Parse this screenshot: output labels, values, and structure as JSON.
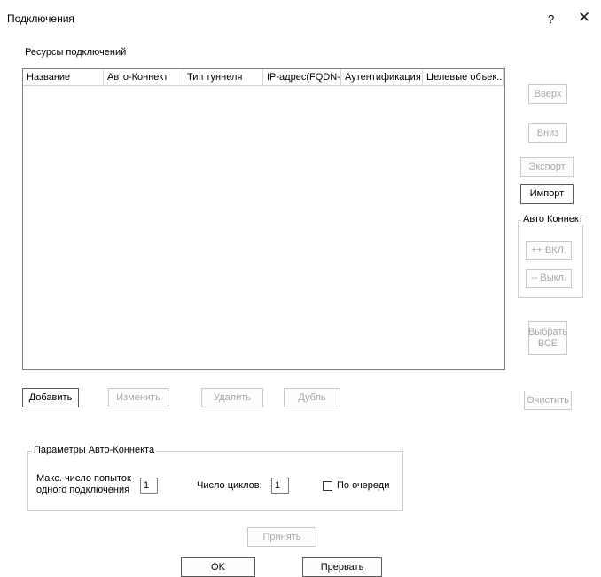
{
  "window": {
    "title": "Подключения",
    "help_label": "?",
    "close_label": "✕"
  },
  "resources": {
    "label": "Ресурсы подключений",
    "columns": [
      "Название",
      "Авто-Коннект",
      "Тип туннеля",
      "IP-адрес(FQDN-...",
      "Аутентификация",
      "Целевые объек..."
    ]
  },
  "side_buttons": {
    "up": "Вверх",
    "down": "Вниз",
    "export": "Экспорт",
    "import": "Импорт",
    "autoconnect_group": "Авто Коннект",
    "on": "++ ВКЛ.",
    "off": "-- Выкл.",
    "select_all_line1": "Выбрать",
    "select_all_line2": "ВСЕ",
    "clear": "Очистить"
  },
  "actions": {
    "add": "Добавить",
    "edit": "Изменить",
    "delete": "Удалить",
    "duplicate": "Дубль"
  },
  "autoconnect_params": {
    "group_label": "Параметры Авто-Коннекта",
    "max_attempts_line1": "Макс. число попыток",
    "max_attempts_line2": "одного подключения",
    "max_attempts_value": "1",
    "cycles_label": "Число циклов:",
    "cycles_value": "1",
    "sequential_label": "По очереди",
    "sequential_checked": false
  },
  "footer": {
    "apply": "Принять",
    "ok": "OK",
    "abort": "Прервать"
  }
}
